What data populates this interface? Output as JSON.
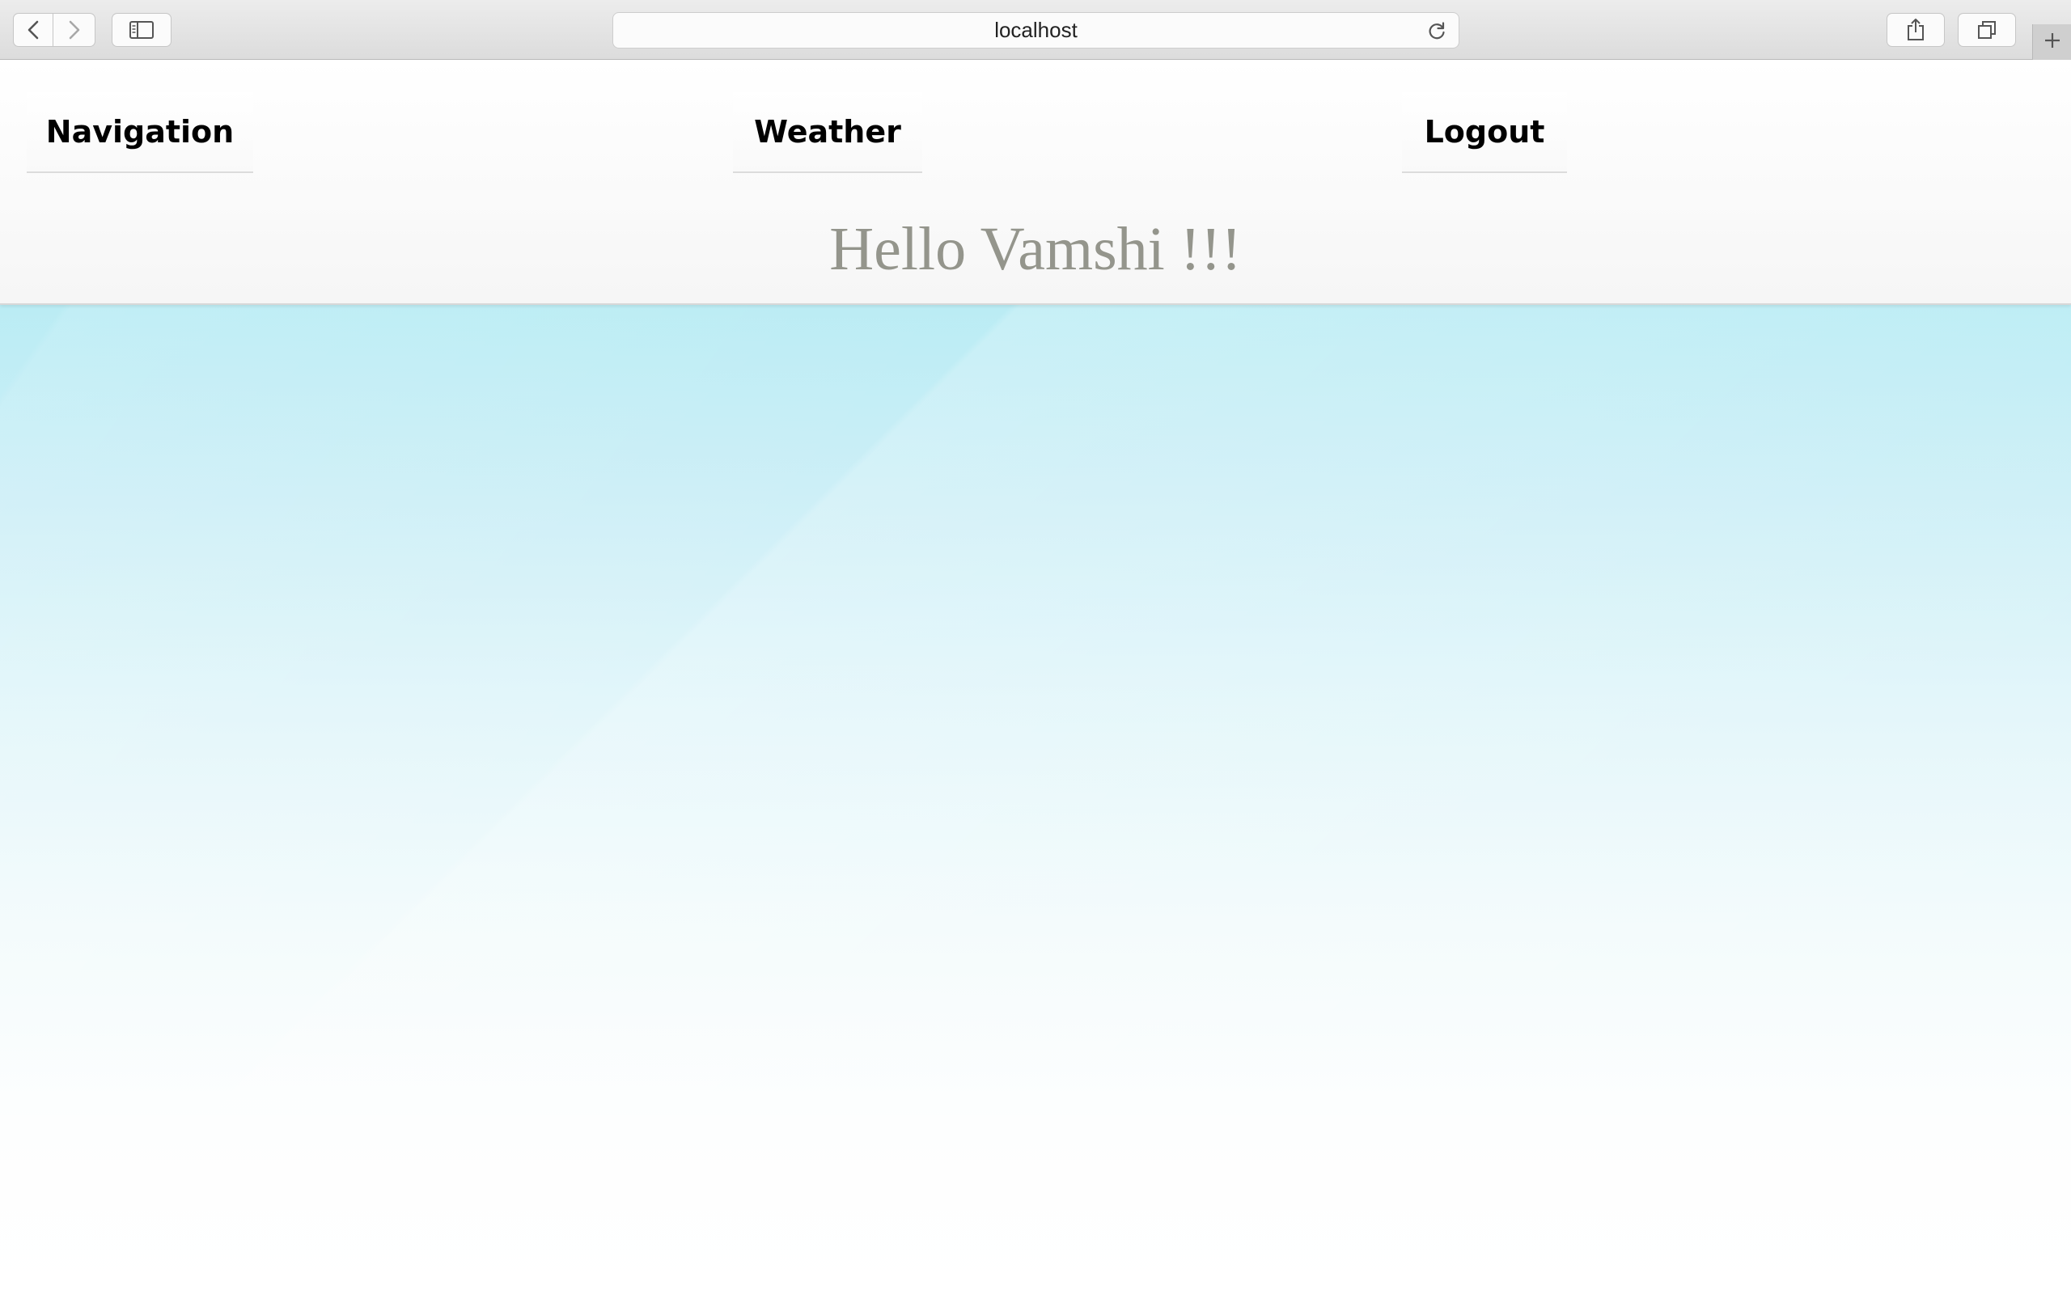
{
  "browser": {
    "url": "localhost",
    "icons": {
      "back": "chevron-left-icon",
      "forward": "chevron-right-icon",
      "sidebar": "sidebar-icon",
      "reload": "reload-icon",
      "share": "share-icon",
      "tabs": "tabs-overview-icon",
      "new_tab": "plus-icon"
    }
  },
  "page": {
    "nav": [
      {
        "label": "Navigation"
      },
      {
        "label": "Weather"
      },
      {
        "label": "Logout"
      }
    ],
    "greeting": "Hello Vamshi !!!",
    "colors": {
      "greeting_text": "#94958c",
      "background_top": "#9ee6ee",
      "background_bottom": "#ffffff"
    }
  }
}
